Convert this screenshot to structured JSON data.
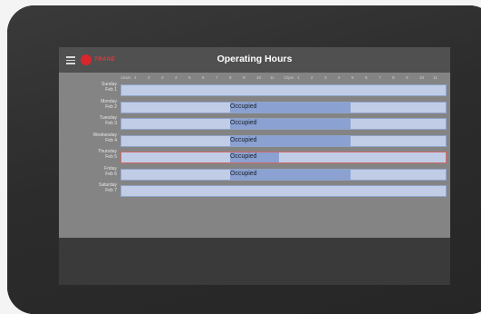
{
  "header": {
    "title": "Operating Hours",
    "brand": "TRANE"
  },
  "hours": [
    "12am",
    "1",
    "2",
    "3",
    "4",
    "5",
    "6",
    "7",
    "8",
    "9",
    "10",
    "11",
    "12pm",
    "1",
    "2",
    "3",
    "4",
    "5",
    "6",
    "7",
    "8",
    "9",
    "10",
    "11"
  ],
  "days": [
    {
      "name": "Sunday",
      "date": "Feb 1",
      "status": "",
      "occupied_fraction": 0
    },
    {
      "name": "Monday",
      "date": "Feb 2",
      "status": "Occupied",
      "occupied_fraction": 0.37
    },
    {
      "name": "Tuesday",
      "date": "Feb 3",
      "status": "Occupied",
      "occupied_fraction": 0.37
    },
    {
      "name": "Wednesday",
      "date": "Feb 4",
      "status": "Occupied",
      "occupied_fraction": 0.37
    },
    {
      "name": "Thursday",
      "date": "Feb 5",
      "status": "Occupied",
      "occupied_fraction": 0.15
    },
    {
      "name": "Friday",
      "date": "Feb 6",
      "status": "Occupied",
      "occupied_fraction": 0.37
    },
    {
      "name": "Saturday",
      "date": "Feb 7",
      "status": "",
      "occupied_fraction": 0
    }
  ],
  "colors": {
    "brand_red": "#d8262b",
    "track": "#c1cde6",
    "occupied": "#8aa1d1",
    "selected_border": "#d2686a"
  }
}
